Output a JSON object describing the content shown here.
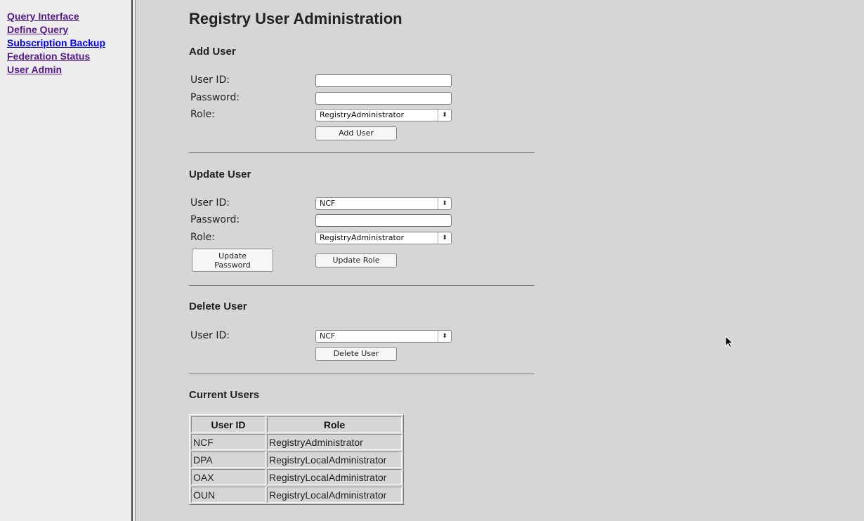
{
  "nav": {
    "items": [
      {
        "label": "Query Interface"
      },
      {
        "label": "Define Query"
      },
      {
        "label": "Subscription Backup"
      },
      {
        "label": "Federation Status"
      },
      {
        "label": "User Admin"
      }
    ]
  },
  "page": {
    "title": "Registry User Administration"
  },
  "add_user": {
    "heading": "Add User",
    "userid_label": "User ID:",
    "password_label": "Password:",
    "role_label": "Role:",
    "userid_value": "",
    "password_value": "",
    "role_selected": "RegistryAdministrator",
    "button": "Add User"
  },
  "update_user": {
    "heading": "Update User",
    "userid_label": "User ID:",
    "password_label": "Password:",
    "role_label": "Role:",
    "userid_selected": "NCF",
    "password_value": "",
    "role_selected": "RegistryAdministrator",
    "update_password_line1": "Update",
    "update_password_line2": "Password",
    "update_role_button": "Update Role"
  },
  "delete_user": {
    "heading": "Delete User",
    "userid_label": "User ID:",
    "userid_selected": "NCF",
    "button": "Delete User"
  },
  "current_users": {
    "heading": "Current Users",
    "columns": [
      "User ID",
      "Role"
    ],
    "rows": [
      [
        "NCF",
        "RegistryAdministrator"
      ],
      [
        "DPA",
        "RegistryLocalAdministrator"
      ],
      [
        "OAX",
        "RegistryLocalAdministrator"
      ],
      [
        "OUN",
        "RegistryLocalAdministrator"
      ]
    ]
  },
  "colors": {
    "nav_visited": "#551a8b",
    "nav_unvisited": "#0000ee",
    "main_bg": "#d6d6d6",
    "nav_bg": "#ededed"
  },
  "icons": {
    "cursor": "mouse-pointer-icon",
    "select_arrow": "up-down-chevron-icon"
  }
}
